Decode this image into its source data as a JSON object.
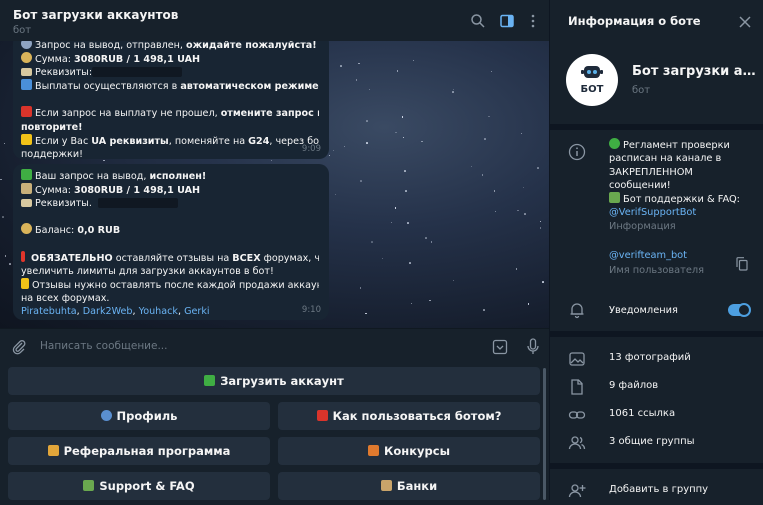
{
  "chat": {
    "title": "Бот загрузки аккаунтов",
    "subtitle": "бот",
    "composer_placeholder": "Написать сообщение..."
  },
  "messages": [
    {
      "lines": [
        {
          "a": "Запрос на вывод, отправлен, ",
          "b": "ожидайте пожалуйста!"
        },
        {
          "a": "Сумма: ",
          "b": "3080RUB / 1 498,1 UAH"
        },
        {
          "a": "Реквизиты:"
        },
        {
          "a": "Выплаты осуществляются в ",
          "b": "автоматическом режиме."
        },
        {
          "a": ""
        },
        {
          "a": "Если запрос на выплату не прошел, ",
          "b": "отмените запрос и"
        },
        {
          "b": "повторите!"
        },
        {
          "a": "Если у Вас ",
          "b": "UA реквизиты",
          "c": ", поменяйте на ",
          "d": "G24",
          "e": ", через бот"
        },
        {
          "a": "поддержки!"
        }
      ],
      "time": "9:09"
    },
    {
      "lines": [
        {
          "a": "Ваш запрос на вывод, ",
          "b": "исполнен!"
        },
        {
          "a": "Сумма: ",
          "b": "3080RUB / 1 498,1 UAH"
        },
        {
          "a": "Реквизиты."
        },
        {
          "a": ""
        },
        {
          "a": "Баланс: ",
          "b": "0,0 RUB"
        },
        {
          "a": ""
        },
        {
          "b": "ОБЯЗАТЕЛЬНО",
          "a": " оставляйте отзывы на ",
          "c": "ВСЕХ",
          "d": " форумах, что бы"
        },
        {
          "a": "увеличить лимиты для загрузки аккаунтов в бот!"
        },
        {
          "a": "Отзывы нужно оставлять после каждой продажи аккаунта,"
        },
        {
          "a": "на всех форумах."
        }
      ],
      "links": [
        "Piratebuhta",
        "Dark2Web",
        "Youhack",
        "Gerki"
      ],
      "time": "9:10"
    }
  ],
  "keyboard": {
    "upload": "Загрузить аккаунт",
    "profile": "Профиль",
    "howto": "Как пользоваться ботом?",
    "referral": "Реферальная программа",
    "contests": "Конкурсы",
    "support": "Support & FAQ",
    "banks": "Банки"
  },
  "panel": {
    "title": "Информация о боте",
    "bot_name": "Бот загрузки аккаунтов",
    "bot_type": "бот",
    "avatar_text": "БОТ",
    "info_lines": [
      "Регламент проверки",
      "расписан на канале в",
      "ЗАКРЕПЛЕННОМ",
      "сообщении!",
      "Бот поддержки & FAQ:"
    ],
    "support_link": "@VerifSupportBot",
    "info_label": "Информация",
    "username": "@verifteam_bot",
    "username_label": "Имя пользователя",
    "notifications": "Уведомления",
    "notifications_on": true,
    "photos": "13 фотографий",
    "files": "9 файлов",
    "links": "1061 ссылка",
    "groups": "3 общие группы",
    "add_group": "Добавить в группу"
  },
  "colors": {
    "accent": "#6ab3f3",
    "bubble": "#182533",
    "panel": "#17212b",
    "toggle": "#4d9fe0"
  }
}
